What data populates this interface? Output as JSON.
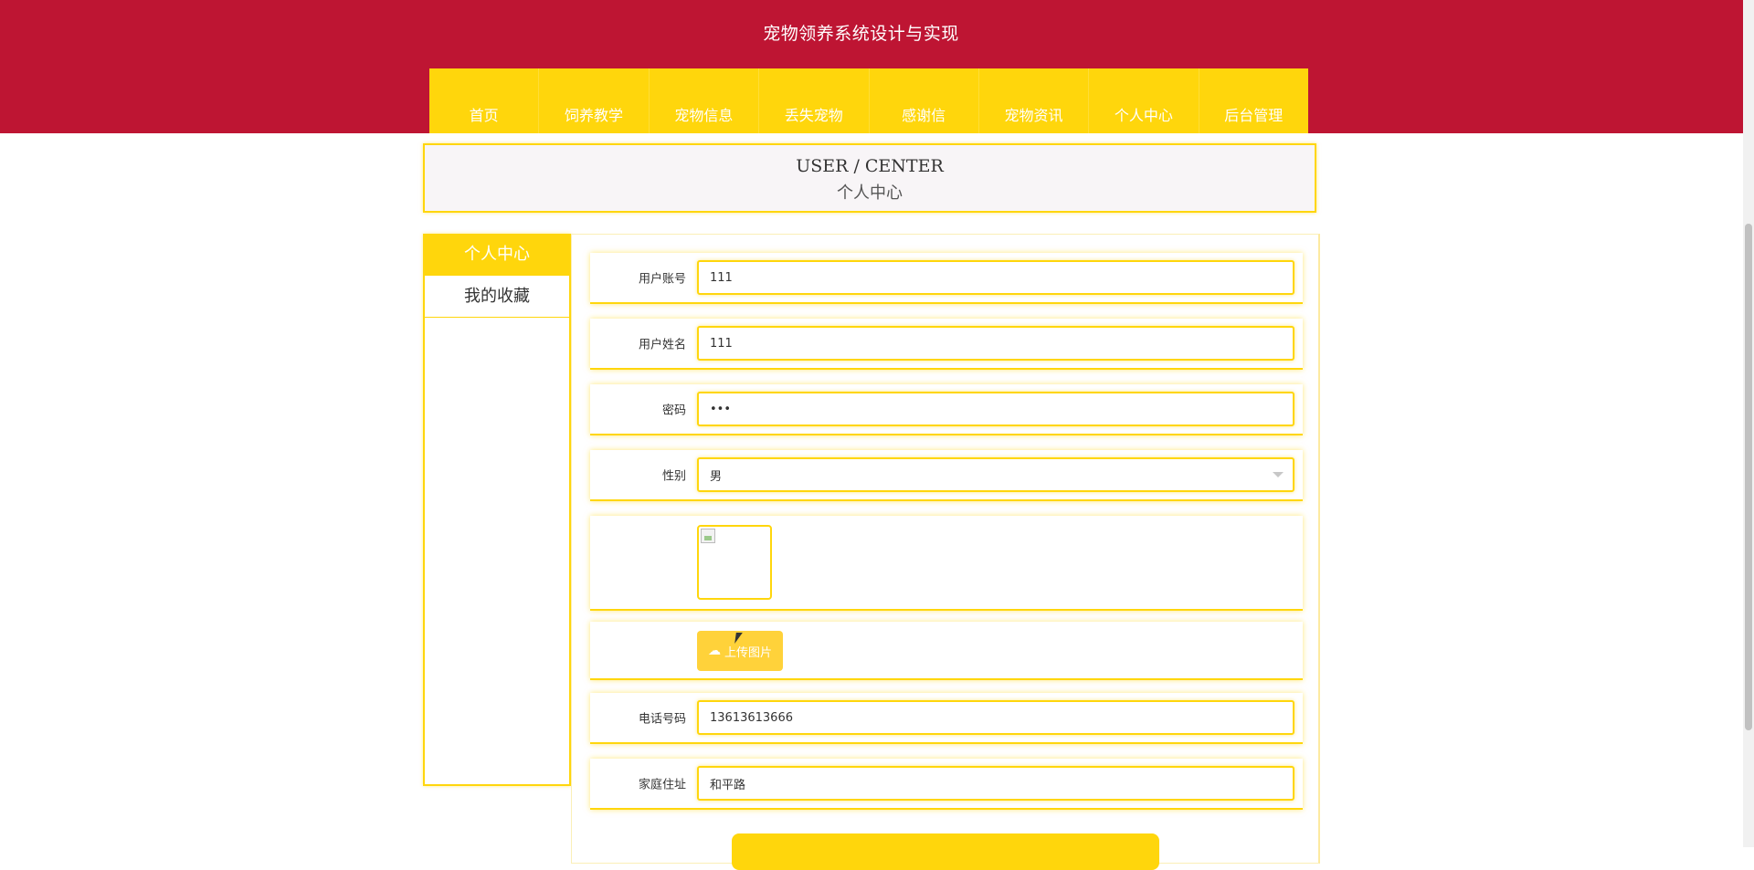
{
  "header": {
    "site_title": "宠物领养系统设计与实现"
  },
  "nav": {
    "items": [
      "首页",
      "饲养教学",
      "宠物信息",
      "丢失宠物",
      "感谢信",
      "宠物资讯",
      "个人中心",
      "后台管理"
    ]
  },
  "page_head": {
    "en": "USER / CENTER",
    "zh": "个人中心"
  },
  "sidebar": {
    "items": [
      {
        "label": "个人中心",
        "active": true
      },
      {
        "label": "我的收藏",
        "active": false
      }
    ]
  },
  "form": {
    "account": {
      "label": "用户账号",
      "value": "111"
    },
    "name": {
      "label": "用户姓名",
      "value": "111"
    },
    "password": {
      "label": "密码",
      "value": "111"
    },
    "gender": {
      "label": "性别",
      "value": "男"
    },
    "upload": {
      "label": "上传图片"
    },
    "phone": {
      "label": "电话号码",
      "value": "13613613666"
    },
    "address": {
      "label": "家庭住址",
      "value": "和平路"
    }
  },
  "colors": {
    "header_red": "#be1533",
    "accent_yellow": "#ffd60c"
  }
}
